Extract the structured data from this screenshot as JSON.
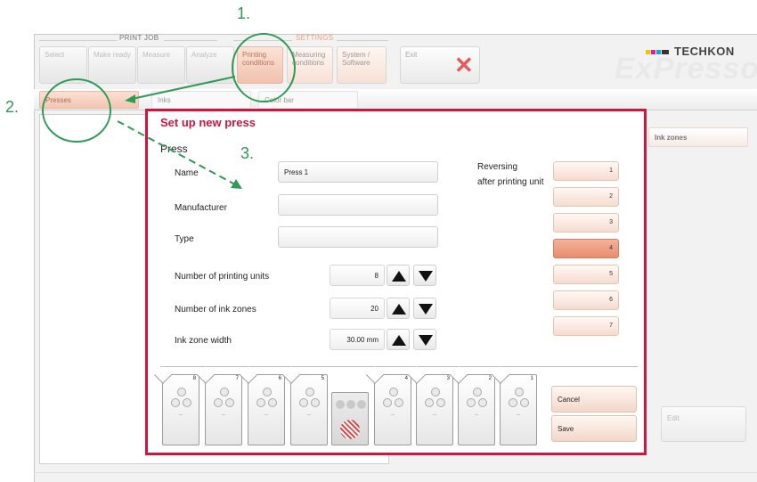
{
  "header": {
    "group_print_job": "PRINT JOB",
    "group_settings": "SETTINGS",
    "tabs": [
      {
        "label": "Select"
      },
      {
        "label": "Make ready"
      },
      {
        "label": "Measure"
      },
      {
        "label": "Analyze"
      },
      {
        "label": "Printing conditions"
      },
      {
        "label": "Measuring conditions"
      },
      {
        "label": "System / Software"
      },
      {
        "label": "Exit"
      }
    ],
    "brand": "TECHKON",
    "product": "ExPresso"
  },
  "subtabs": [
    {
      "label": "Presses"
    },
    {
      "label": "Inks"
    },
    {
      "label": "Color bar"
    }
  ],
  "right_panel": {
    "header": "Ink zones",
    "edit_label": "Edit"
  },
  "dialog": {
    "title": "Set up new press",
    "section": "Press",
    "name_label": "Name",
    "name_value": "Press 1",
    "manufacturer_label": "Manufacturer",
    "manufacturer_value": "",
    "type_label": "Type",
    "type_value": "",
    "printing_units_label": "Number of printing units",
    "printing_units_value": "8",
    "ink_zones_label": "Number of ink zones",
    "ink_zones_value": "20",
    "ink_zone_width_label": "Ink zone width",
    "ink_zone_width_value": "30.00 mm",
    "reversing_label_1": "Reversing",
    "reversing_label_2": "after printing unit",
    "reversing_units": [
      "1",
      "2",
      "3",
      "4",
      "5",
      "6",
      "7"
    ],
    "reversing_selected": "4",
    "units_left": [
      "8",
      "7",
      "6",
      "5"
    ],
    "units_right": [
      "4",
      "3",
      "2",
      "1"
    ],
    "unit_dash": "--",
    "cancel_label": "Cancel",
    "save_label": "Save"
  },
  "annotations": [
    "1.",
    "2.",
    "3."
  ],
  "colors": {
    "accent": "#d0153f",
    "annotation": "#2d9b55",
    "selected_unit": "#e88c6e"
  }
}
